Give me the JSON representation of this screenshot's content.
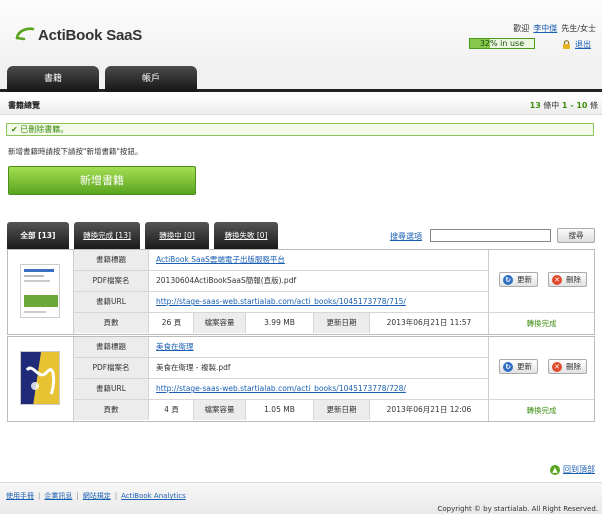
{
  "header": {
    "logo_text": "ActiBook SaaS",
    "greeting": "歡迎",
    "user_name": "李中傑",
    "honorific": "先生/女士",
    "usage_text": "32% in use",
    "usage_percent": 32,
    "logout_label": "退出"
  },
  "main_tabs": [
    {
      "label": "書籍"
    },
    {
      "label": "帳戶"
    }
  ],
  "section": {
    "title": "書籍總覽",
    "total": "13",
    "count_mid": "條中",
    "range": "1 - 10",
    "count_suffix": "條"
  },
  "alert": "已刪除書籍。",
  "hint": "新增書籍時請按下請按\"新增書籍\"按鈕。",
  "add_button": "新增書籍",
  "filter_tabs": [
    {
      "label": "全部 [13]",
      "active": true
    },
    {
      "label": "轉換完成 [13]",
      "active": false
    },
    {
      "label": "轉換中 [0]",
      "active": false
    },
    {
      "label": "轉換失敗 [0]",
      "active": false
    }
  ],
  "search": {
    "advanced_label": "搜尋選項",
    "value": "",
    "button_label": "搜尋"
  },
  "labels": {
    "title": "書籍標題",
    "pdf": "PDF檔案名",
    "url": "書籍URL",
    "pages": "頁數",
    "size": "檔案容量",
    "date": "更新日期",
    "update": "更新",
    "delete": "刪除"
  },
  "books": [
    {
      "title": "ActiBook SaaS雲端電子出版服務平台",
      "pdf": "20130604ActiBookSaaS簡報(直版).pdf",
      "url": "http://stage-saas-web.startialab.com/acti_books/1045173778/715/",
      "pages": "26 頁",
      "size": "3.99 MB",
      "date": "2013年06月21日 11:57",
      "status": "轉換完成"
    },
    {
      "title": "美食在衛理",
      "pdf": "美食在衛理 - 複製.pdf",
      "url": "http://stage-saas-web.startialab.com/acti_books/1045173778/728/",
      "pages": "4 頁",
      "size": "1.05 MB",
      "date": "2013年06月21日 12:06",
      "status": "轉換完成"
    }
  ],
  "back_to_top": "回到頂部",
  "footer": {
    "links": [
      {
        "label": "使用手冊"
      },
      {
        "label": "企業訊息"
      },
      {
        "label": "網站規定"
      },
      {
        "label": "ActiBook Analytics"
      }
    ],
    "separator": "|",
    "copyright": "Copyright © by startialab. All Right Reserved."
  },
  "colors": {
    "accent_green": "#5aa520",
    "link_blue": "#1a5fb4",
    "tab_black": "#151515"
  }
}
